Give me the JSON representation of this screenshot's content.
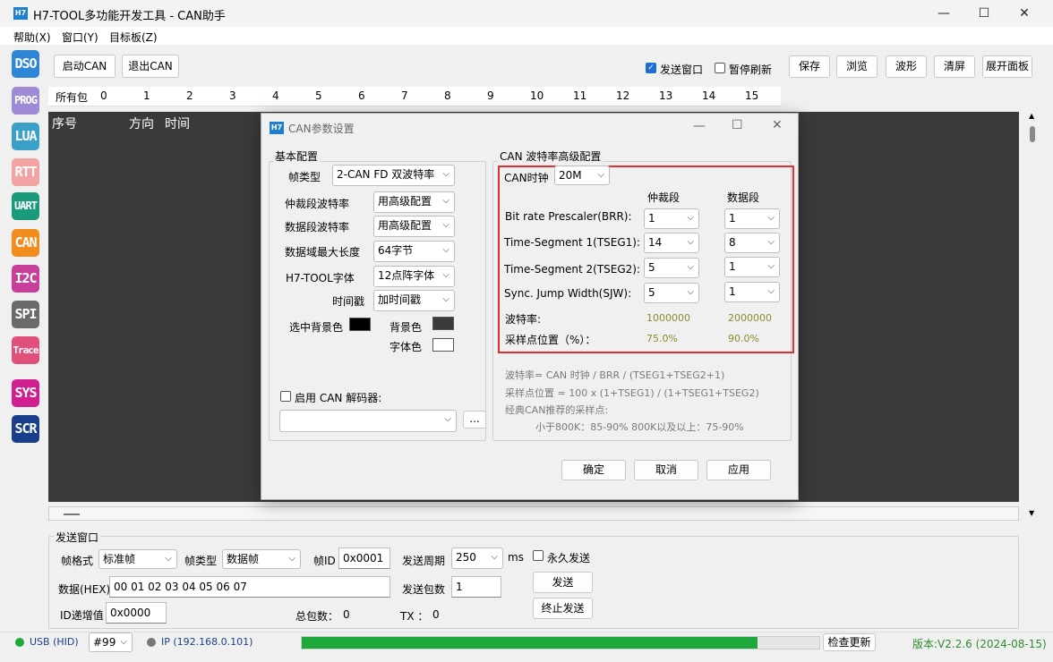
{
  "app": {
    "icon": "H7",
    "title": "H7-TOOL多功能开发工具 - CAN助手"
  },
  "menu": [
    "帮助(X)",
    "窗口(Y)",
    "目标板(Z)"
  ],
  "sidebar": [
    "DSO",
    "PROG",
    "LUA",
    "RTT",
    "UART",
    "CAN",
    "I2C",
    "SPI",
    "Trace",
    "SYS",
    "SCR"
  ],
  "toolbar": {
    "start": "启动CAN",
    "exit": "退出CAN",
    "send_window": "发送窗口",
    "pause_refresh": "暂停刷新",
    "save": "保存",
    "browse": "浏览",
    "wave": "波形",
    "clear": "清屏",
    "expand": "展开面板"
  },
  "tabs": [
    "所有包",
    "0",
    "1",
    "2",
    "3",
    "4",
    "5",
    "6",
    "7",
    "8",
    "9",
    "10",
    "11",
    "12",
    "13",
    "14",
    "15"
  ],
  "grid_headers": {
    "seq": "序号",
    "dir": "方向",
    "time": "时间"
  },
  "dialog": {
    "icon": "H7",
    "title": "CAN参数设置",
    "basic": {
      "title": "基本配置",
      "frame_type_label": "帧类型",
      "frame_type": "2-CAN FD 双波特率",
      "arb_rate_label": "仲裁段波特率",
      "arb_rate": "用高级配置",
      "data_rate_label": "数据段波特率",
      "data_rate": "用高级配置",
      "max_len_label": "数据域最大长度",
      "max_len": "64字节",
      "font_label": "H7-TOOL字体",
      "font": "12点阵字体",
      "timestamp_label": "时间戳",
      "timestamp": "加时间戳",
      "sel_bg_label": "选中背景色",
      "bg_label": "背景色",
      "fg_label": "字体色",
      "decoder_label": "启用 CAN 解码器:",
      "browse_btn": "..."
    },
    "advanced": {
      "title": "CAN 波特率高级配置",
      "clock_label": "CAN时钟",
      "clock": "20M",
      "col_arb": "仲裁段",
      "col_data": "数据段",
      "rows": [
        {
          "label": "Bit rate  Prescaler(BRR):",
          "arb": "1",
          "data": "1"
        },
        {
          "label": "Time-Segment 1(TSEG1):",
          "arb": "14",
          "data": "8"
        },
        {
          "label": "Time-Segment 2(TSEG2):",
          "arb": "5",
          "data": "1"
        },
        {
          "label": "Sync. Jump Width(SJW):",
          "arb": "5",
          "data": "1"
        }
      ],
      "rate_label": "波特率:",
      "rate_arb": "1000000",
      "rate_data": "2000000",
      "sample_label": "采样点位置（%）：",
      "sample_arb": "75.0%",
      "sample_data": "90.0%",
      "notes": [
        "波特率= CAN 时钟 / BRR / (TSEG1+TSEG2+1)",
        "采样点位置 = 100 x (1+TSEG1) / (1+TSEG1+TSEG2)",
        "经典CAN推荐的采样点:",
        "小于800K：85-90%    800K以及以上：75-90%"
      ]
    },
    "ok": "确定",
    "cancel": "取消",
    "apply": "应用"
  },
  "send": {
    "title": "发送窗口",
    "frame_format_label": "帧格式",
    "frame_format": "标准帧",
    "frame_type_label": "帧类型",
    "frame_type": "数据帧",
    "frame_id_label": "帧ID",
    "frame_id": "0x0001",
    "period_label": "发送周期",
    "period": "250",
    "period_unit": "ms",
    "forever_label": "永久发送",
    "data_label": "数据(HEX)",
    "data": "00 01 02 03 04 05 06 07",
    "count_label": "发送包数",
    "count": "1",
    "send_btn": "发送",
    "stop_btn": "终止发送",
    "id_inc_label": "ID递增值",
    "id_inc": "0x0000",
    "total_label": "总包数：",
    "total": "0",
    "tx_label": "TX ：",
    "tx": "0"
  },
  "status": {
    "usb": "USB (HID)",
    "device": "#99",
    "ip": "IP (192.168.0.101)",
    "progress": 0.88,
    "check_update": "检查更新",
    "version": "版本:V2.2.6 (2024-08-15)"
  },
  "colors": {
    "sidebar": [
      "#2f86d6",
      "#9f8ad6",
      "#3aa0c8",
      "#f2a3a3",
      "#1a9a7a",
      "#f28c1c",
      "#c73f9a",
      "#6a6a6a",
      "#e0507a",
      "#d02090",
      "#1a3f8a"
    ],
    "highlight": "#e03030",
    "progress": "#1fa83a",
    "accent": "#1c6fd1"
  }
}
